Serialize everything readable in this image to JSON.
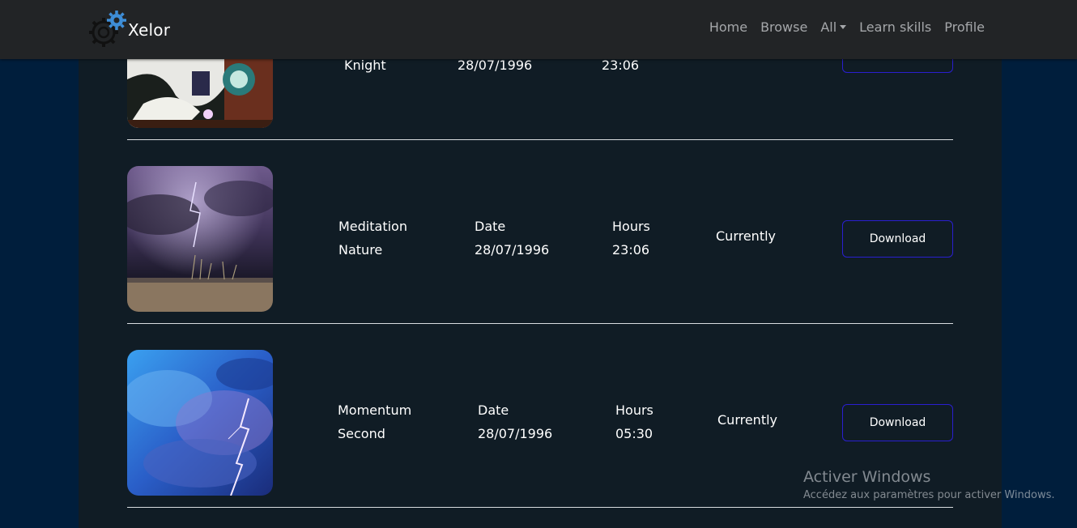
{
  "brand": {
    "name": "Xelor",
    "logo_icon": "gears-icon",
    "accent": "#3e8ed8"
  },
  "nav": {
    "items": [
      {
        "label": "Home"
      },
      {
        "label": "Browse"
      },
      {
        "label": "All",
        "dropdown": true
      },
      {
        "label": "Learn skills"
      },
      {
        "label": "Profile"
      }
    ]
  },
  "rows": [
    {
      "title_line1": "",
      "title_line2": "Knight",
      "date_label": "",
      "date_value": "28/07/1996",
      "hours_label": "",
      "hours_value": "23:06",
      "status": "",
      "button_label": "Download"
    },
    {
      "title_line1": "Meditation",
      "title_line2": "Nature",
      "date_label": "Date",
      "date_value": "28/07/1996",
      "hours_label": "Hours",
      "hours_value": "23:06",
      "status": "Currently",
      "button_label": "Download"
    },
    {
      "title_line1": "Momentum",
      "title_line2": "Second",
      "date_label": "Date",
      "date_value": "28/07/1996",
      "hours_label": "Hours",
      "hours_value": "05:30",
      "status": "Currently",
      "button_label": "Download"
    }
  ],
  "watermark": {
    "title": "Activer Windows",
    "subtitle": "Accédez aux paramètres pour activer Windows."
  },
  "colors": {
    "background": "#001e3c",
    "panel": "#101c25",
    "navbar": "#222426",
    "button_border": "#2a1fd0"
  }
}
